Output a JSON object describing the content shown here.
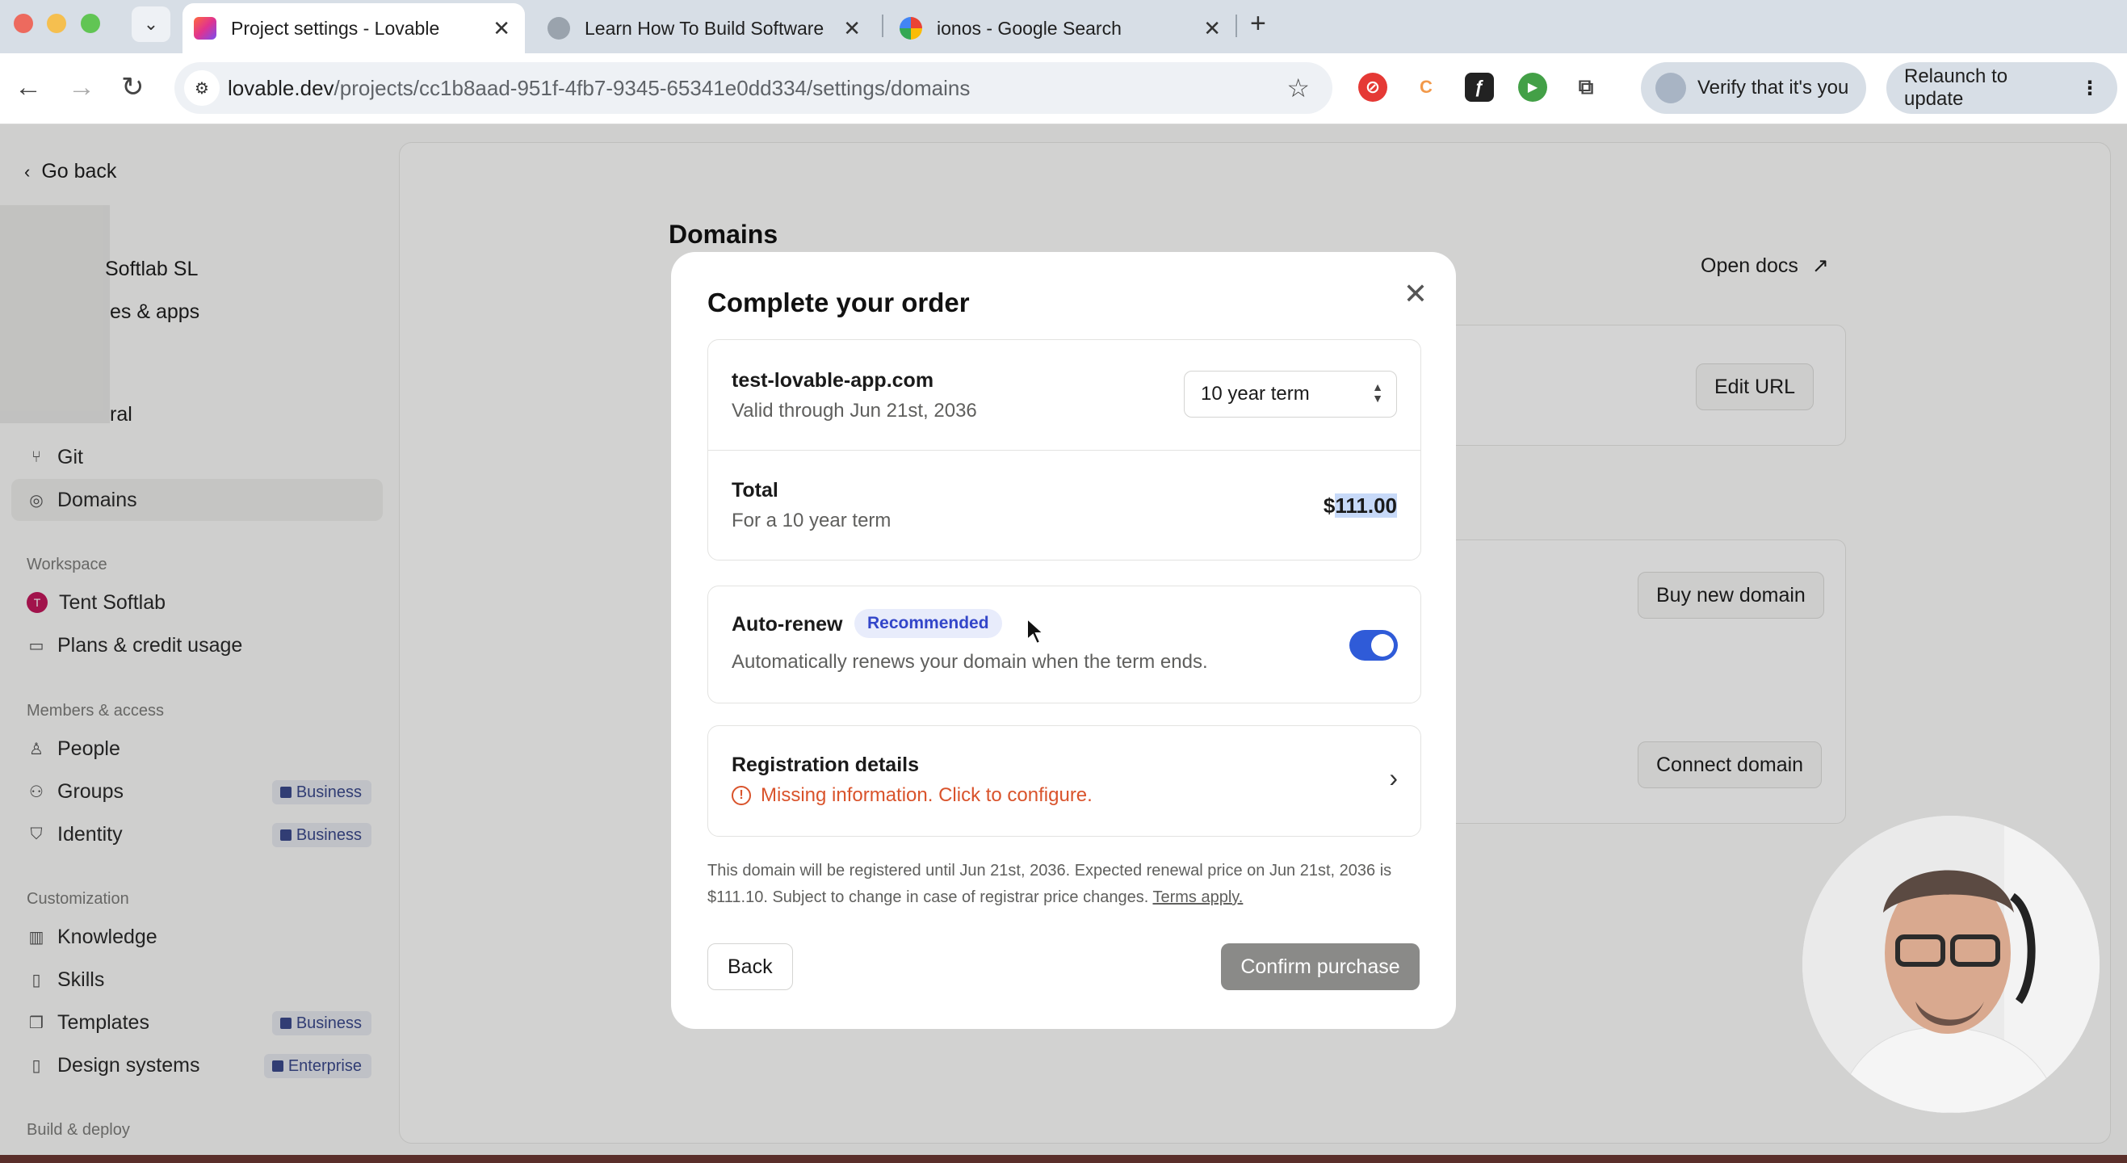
{
  "browser": {
    "tabs": [
      {
        "title": "Project settings - Lovable",
        "active": true
      },
      {
        "title": "Learn How To Build Software",
        "active": false
      },
      {
        "title": "ionos - Google Search",
        "active": false
      }
    ],
    "url_host": "lovable.dev",
    "url_path": "/projects/cc1b8aad-951f-4fb7-9345-65341e0dd334/settings/domains",
    "verify_label": "Verify that it's you",
    "relaunch_label": "Relaunch to update"
  },
  "sidebar": {
    "go_back": "Go back",
    "partial_workspace": "Softlab SL",
    "partial_sites": "es & apps",
    "partial_general": "ral",
    "project_items": [
      {
        "label": "Git",
        "icon": "git-icon"
      },
      {
        "label": "Domains",
        "icon": "globe-icon",
        "active": true
      }
    ],
    "workspace_section": "Workspace",
    "workspace_items": [
      {
        "label": "Tent Softlab",
        "avatar": "T"
      },
      {
        "label": "Plans & credit usage"
      }
    ],
    "members_section": "Members & access",
    "members_items": [
      {
        "label": "People"
      },
      {
        "label": "Groups",
        "badge": "Business"
      },
      {
        "label": "Identity",
        "badge": "Business"
      }
    ],
    "customization_section": "Customization",
    "customization_items": [
      {
        "label": "Knowledge"
      },
      {
        "label": "Skills"
      },
      {
        "label": "Templates",
        "badge": "Business"
      },
      {
        "label": "Design systems",
        "badge": "Enterprise"
      }
    ],
    "build_section": "Build & deploy"
  },
  "main": {
    "title": "Domains",
    "open_docs": "Open docs",
    "edit_url": "Edit URL",
    "buy_new_domain": "Buy new domain",
    "connect_domain": "Connect domain"
  },
  "modal": {
    "title": "Complete your order",
    "domain": "test-lovable-app.com",
    "valid_through": "Valid through Jun 21st, 2036",
    "term_selected": "10 year term",
    "total_label": "Total",
    "total_sub": "For a 10 year term",
    "price_currency": "$",
    "price_value": "111.00",
    "auto_renew_label": "Auto-renew",
    "auto_renew_badge": "Recommended",
    "auto_renew_desc": "Automatically renews your domain when the term ends.",
    "auto_renew_enabled": true,
    "registration_label": "Registration details",
    "registration_warning": "Missing information. Click to configure.",
    "fineprint": "This domain will be registered until Jun 21st, 2036. Expected renewal price on Jun 21st, 2036 is $111.10. Subject to change in case of registrar price changes.",
    "terms_link": "Terms apply.",
    "back_label": "Back",
    "confirm_label": "Confirm purchase"
  },
  "colors": {
    "accent": "#2f5bd8",
    "warning": "#d9532b",
    "badge_text": "#3346c9"
  }
}
